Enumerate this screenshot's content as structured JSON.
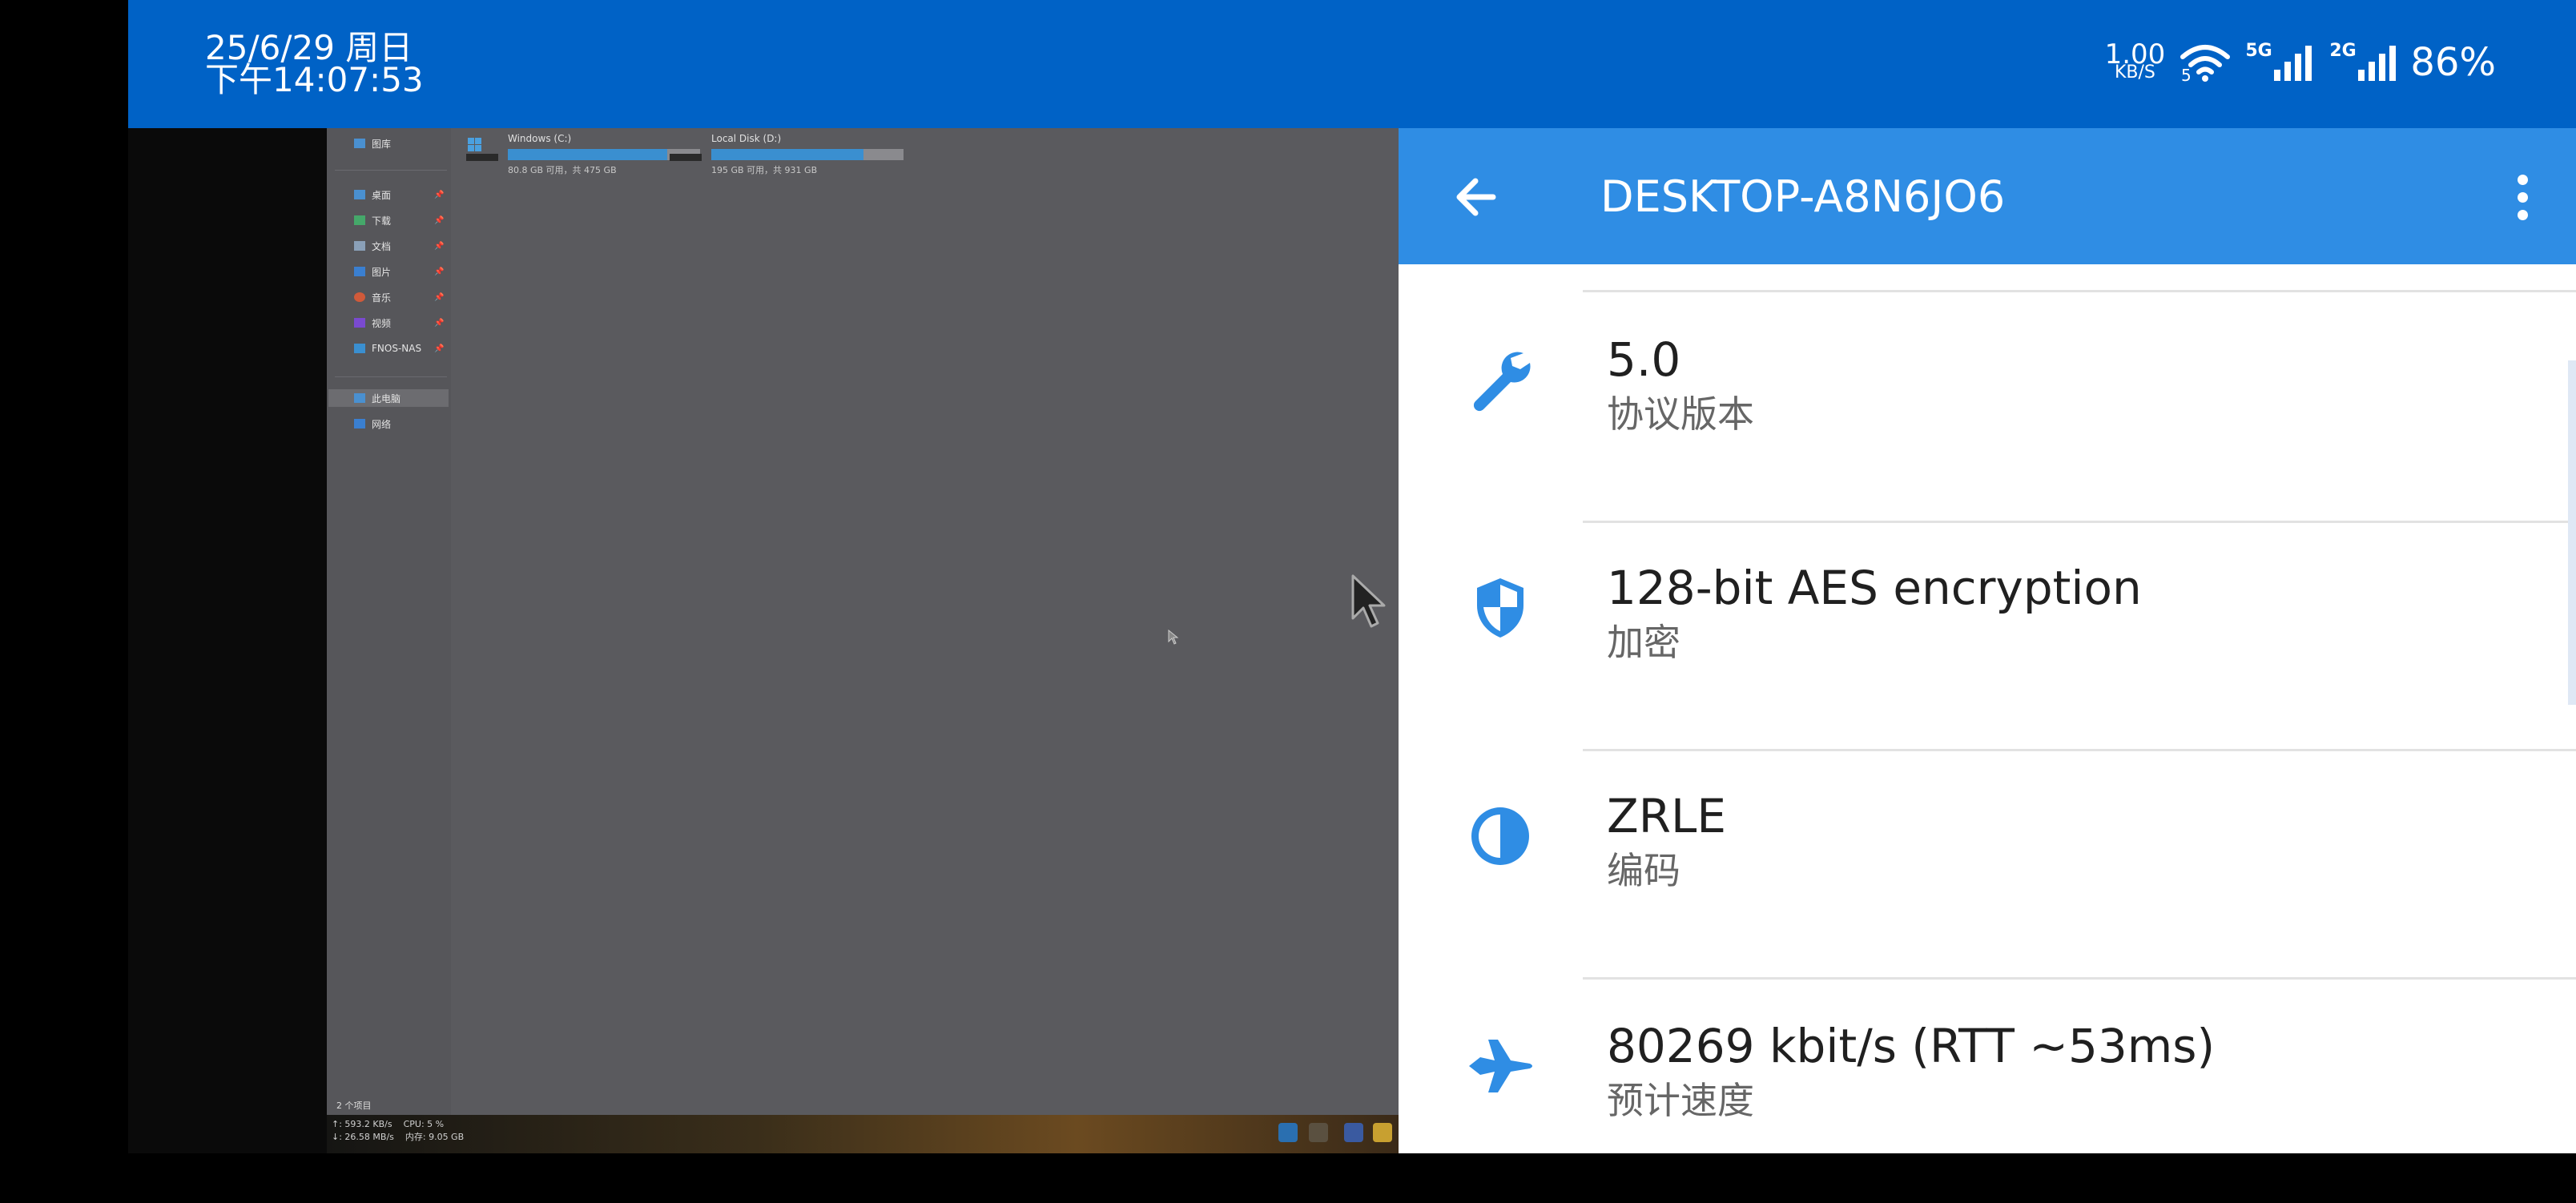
{
  "status_bar": {
    "date": "25/6/29 周日",
    "time": "下午14:07:53",
    "net_speed_value": "1.00",
    "net_speed_unit": "KB/S",
    "wifi_badge": "5",
    "signal1_tag": "5G",
    "signal2_tag": "2G",
    "battery": "86%"
  },
  "remote_desktop": {
    "nav": {
      "gallery": "图库",
      "desktop": "桌面",
      "downloads": "下载",
      "documents": "文档",
      "pictures": "图片",
      "music": "音乐",
      "videos": "视频",
      "nas": "FNOS-NAS",
      "this_pc": "此电脑",
      "network": "网络"
    },
    "drives": [
      {
        "name": "Windows (C:)",
        "size": "80.8 GB 可用，共 475 GB",
        "used_fraction": 0.83
      },
      {
        "name": "Local Disk (D:)",
        "size": "195 GB 可用，共 931 GB",
        "used_fraction": 0.79
      }
    ],
    "item_count": "2 个项目",
    "perf_line1": "↑: 593.2 KB/s    CPU: 5 %",
    "perf_line2": "↓: 26.58 MB/s    内存: 9.05 GB"
  },
  "panel": {
    "title": "DESKTOP-A8N6JO6",
    "items": [
      {
        "value": "5.0",
        "label": "协议版本",
        "icon": "wrench-icon"
      },
      {
        "value": "128-bit AES encryption",
        "label": "加密",
        "icon": "shield-icon"
      },
      {
        "value": "ZRLE",
        "label": "编码",
        "icon": "contrast-icon"
      },
      {
        "value": "80269 kbit/s (RTT ~53ms)",
        "label": "预计速度",
        "icon": "airplane-icon"
      }
    ]
  },
  "colors": {
    "status_bar": "#0062c6",
    "app_bar": "#2f8de4",
    "icon_blue": "#2f8de4"
  }
}
